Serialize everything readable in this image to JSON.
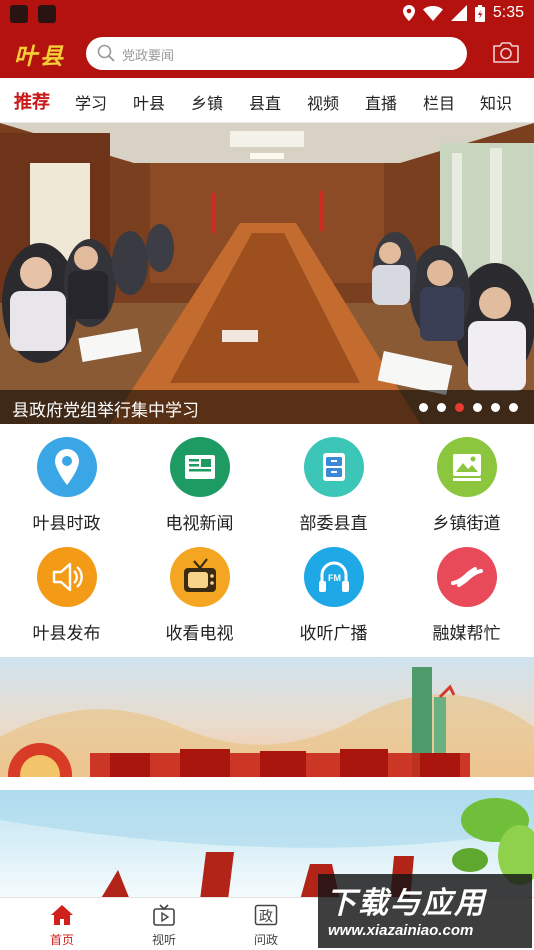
{
  "status_bar": {
    "time": "5:35"
  },
  "header": {
    "logo": "叶县",
    "search_placeholder": "党政要闻"
  },
  "tabs": [
    "推荐",
    "学习",
    "叶县",
    "乡镇",
    "县直",
    "视频",
    "直播",
    "栏目",
    "知识"
  ],
  "active_tab": "推荐",
  "banner": {
    "caption": "县政府党组举行集中学习",
    "slide_count": 6,
    "active_slide": 3
  },
  "grid": [
    {
      "label": "叶县时政",
      "icon": "location-pin-icon",
      "color": "#3aa6e6"
    },
    {
      "label": "电视新闻",
      "icon": "tv-news-icon",
      "color": "#1e9a63"
    },
    {
      "label": "部委县直",
      "icon": "cabinet-icon",
      "color": "#3cc6b8"
    },
    {
      "label": "乡镇街道",
      "icon": "landscape-icon",
      "color": "#8cc63e"
    },
    {
      "label": "叶县发布",
      "icon": "speaker-icon",
      "color": "#f39a17"
    },
    {
      "label": "收看电视",
      "icon": "retro-tv-icon",
      "color": "#f4a623"
    },
    {
      "label": "收听广播",
      "icon": "fm-radio-icon",
      "color": "#1ea8e6"
    },
    {
      "label": "融媒帮忙",
      "icon": "helping-hands-icon",
      "color": "#e84a5a"
    }
  ],
  "bottom_nav": [
    {
      "label": "首页",
      "icon": "home-icon"
    },
    {
      "label": "视听",
      "icon": "video-icon"
    },
    {
      "label": "问政",
      "icon": "government-icon"
    }
  ],
  "active_nav": "首页",
  "watermark": {
    "title": "下载与应用",
    "url": "www.xiazainiao.com"
  },
  "colors": {
    "brand_red": "#b3120f",
    "logo_gold": "#f5cf36",
    "active_red": "#c8181a"
  }
}
